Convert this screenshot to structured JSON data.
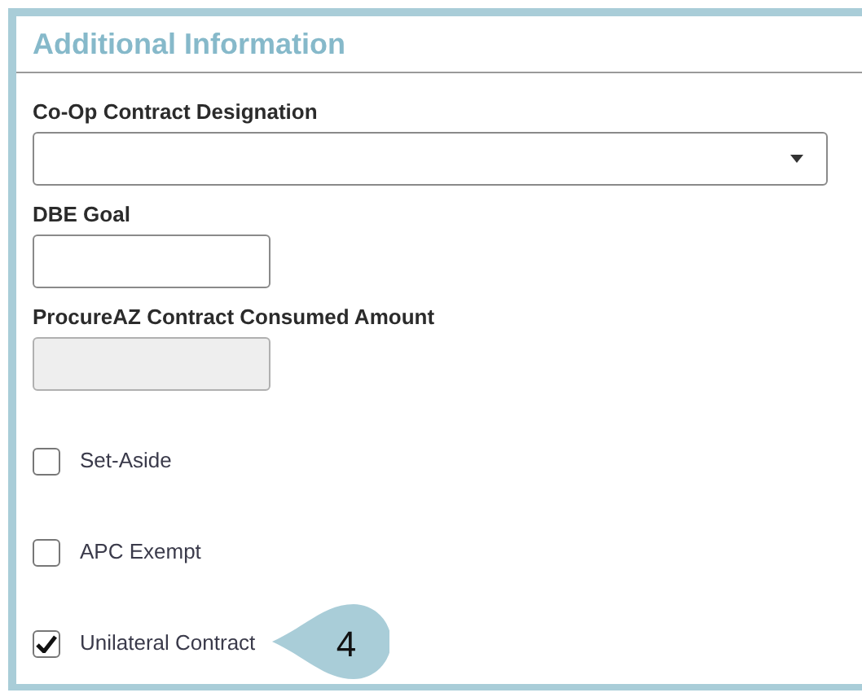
{
  "section": {
    "title": "Additional Information"
  },
  "fields": [
    {
      "kind": "select",
      "label": "Co-Op Contract Designation",
      "disabled": false
    },
    {
      "kind": "text",
      "label": "DBE Goal",
      "disabled": false
    },
    {
      "kind": "text",
      "label": "ProcureAZ Contract Consumed Amount",
      "disabled": true
    }
  ],
  "checkboxes": [
    {
      "label": "Set-Aside",
      "checked": false
    },
    {
      "label": "APC Exempt",
      "checked": false
    },
    {
      "label": "Unilateral Contract",
      "checked": true,
      "callout": "4"
    }
  ]
}
